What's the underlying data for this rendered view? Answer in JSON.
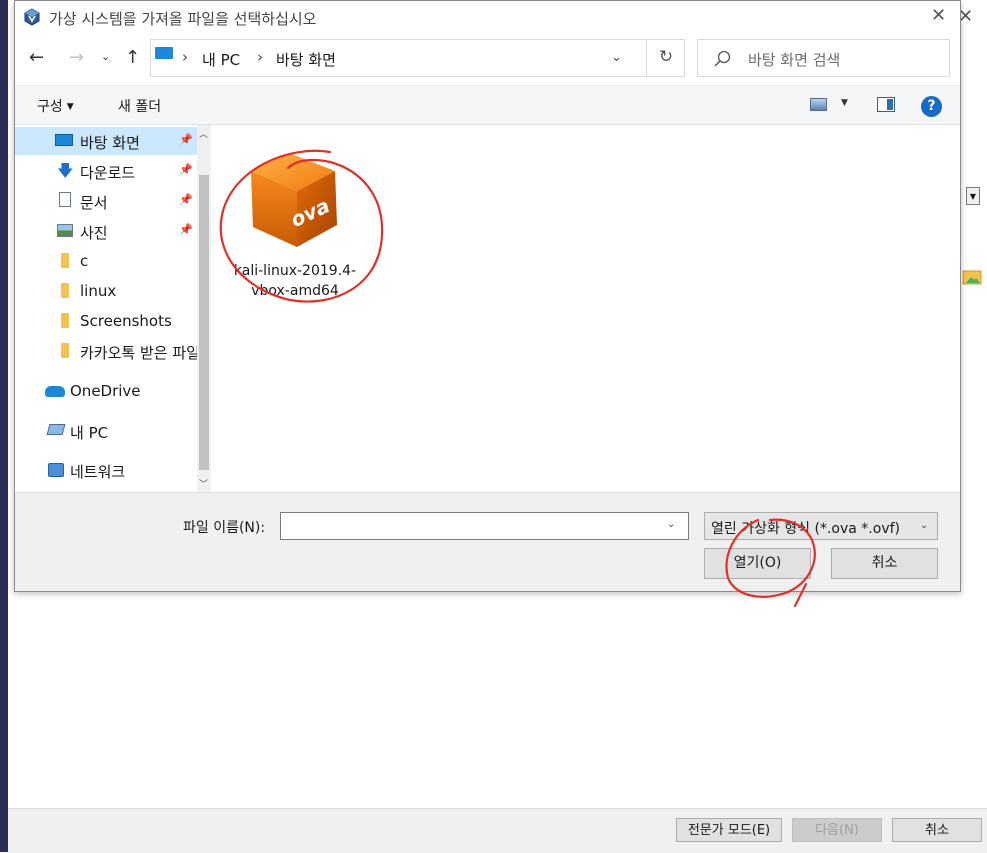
{
  "background_window": {
    "buttons": {
      "expert_mode": "전문가 모드(E)",
      "next": "다음(N)",
      "cancel": "취소"
    }
  },
  "dialog": {
    "title": "가상 시스템을 가져올 파일을 선택하십시오",
    "breadcrumb": [
      "내 PC",
      "바탕 화면"
    ],
    "search_placeholder": "바탕 화면 검색",
    "toolbar": {
      "organize": "구성",
      "new_folder": "새 폴더"
    },
    "sidebar": {
      "items": [
        {
          "label": "바탕 화면",
          "icon": "desktop-icon",
          "pinned": true,
          "selected": true
        },
        {
          "label": "다운로드",
          "icon": "download-icon",
          "pinned": true
        },
        {
          "label": "문서",
          "icon": "document-icon",
          "pinned": true
        },
        {
          "label": "사진",
          "icon": "pictures-icon",
          "pinned": true
        },
        {
          "label": "c",
          "icon": "folder-icon"
        },
        {
          "label": "linux",
          "icon": "folder-icon"
        },
        {
          "label": "Screenshots",
          "icon": "folder-icon"
        },
        {
          "label": "카카오톡 받은 파일",
          "icon": "folder-icon"
        },
        {
          "label": "OneDrive",
          "icon": "onedrive-icon"
        },
        {
          "label": "내 PC",
          "icon": "this-pc-icon"
        },
        {
          "label": "네트워크",
          "icon": "network-icon"
        }
      ]
    },
    "files": [
      {
        "name": "kali-linux-2019.4-vbox-amd64",
        "icon": "ova-file-icon",
        "icon_text": "ova"
      }
    ],
    "filename_label": "파일 이름(N):",
    "filename_value": "",
    "filetype": "열린 가상화 형식 (*.ova *.ovf)",
    "buttons": {
      "open": "열기(O)",
      "cancel": "취소"
    }
  },
  "colors": {
    "selection": "#cce8ff",
    "accent": "#1e88d8",
    "annotation": "#e0302a",
    "ova_orange": "#f07a10"
  }
}
